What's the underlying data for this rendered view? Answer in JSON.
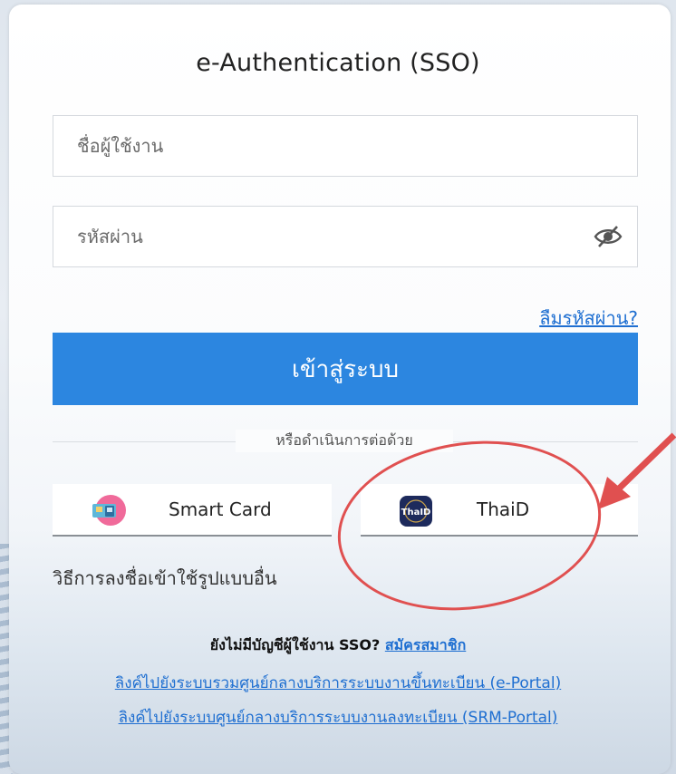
{
  "title": "e-Authentication (SSO)",
  "username": {
    "placeholder": "ชื่อผู้ใช้งาน",
    "value": ""
  },
  "password": {
    "placeholder": "รหัสผ่าน",
    "value": ""
  },
  "forgot_password": "ลืมรหัสผ่าน?",
  "login_button": "เข้าสู่ระบบ",
  "divider_text": "หรือดำเนินการต่อด้วย",
  "alt_login": [
    {
      "label": "Smart Card",
      "icon": "smart-card-icon"
    },
    {
      "label": "ThaiD",
      "icon": "thaid-icon"
    }
  ],
  "thaid_logo_text": "ThaID",
  "other_methods": "วิธีการลงชื่อเข้าใช้รูปแบบอื่น",
  "signup": {
    "prompt": "ยังไม่มีบัญชีผู้ใช้งาน SSO?",
    "link": "สมัครสมาชิก"
  },
  "links": [
    "ลิงค์ไปยังระบบรวมศูนย์กลางบริการระบบงานขึ้นทะเบียน (e-Portal)",
    "ลิงค์ไปยังระบบศูนย์กลางบริการระบบงานลงทะเบียน (SRM-Portal)"
  ],
  "colors": {
    "primary": "#2c86e0",
    "link": "#1f6fd1",
    "annotation": "#e05050"
  }
}
